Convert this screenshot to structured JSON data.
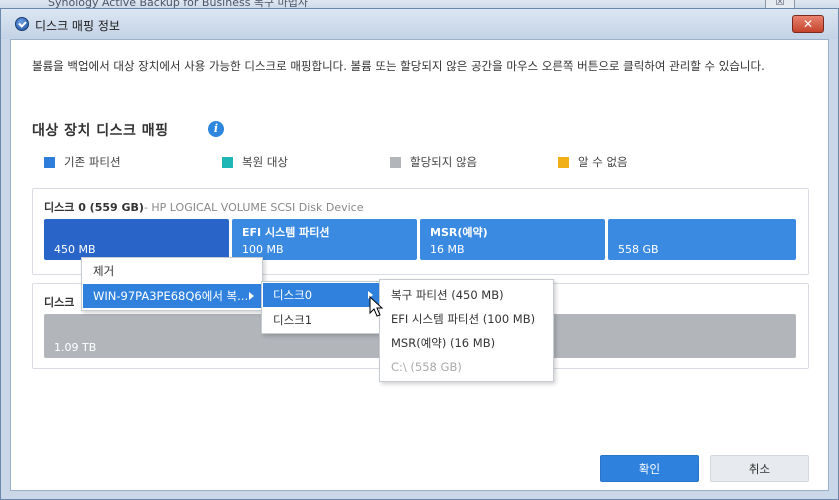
{
  "background_window": {
    "title": "Synology Active Backup for Business 복구 마법사",
    "close_label": "☒"
  },
  "dialog": {
    "title": "디스크 매핑 정보",
    "close_label": "✕",
    "description": "볼륨을 백업에서 대상 장치에서 사용 가능한 디스크로 매핑합니다. 볼륨 또는 할당되지 않은 공간을 마우스 오른쪽 버튼으로 클릭하여 관리할 수 있습니다.",
    "section_title": "대상 장치 디스크 매핑",
    "info_icon": "i"
  },
  "legend": [
    {
      "label": "기존 파티션",
      "color": "#2f7ddb"
    },
    {
      "label": "복원 대상",
      "color": "#1fb6b6"
    },
    {
      "label": "할당되지 않음",
      "color": "#b2b6bb"
    },
    {
      "label": "알 수 없음",
      "color": "#f2b017"
    }
  ],
  "disks": [
    {
      "name": "디스크 0 (559 GB)",
      "model": "- HP LOGICAL VOLUME SCSI Disk Device",
      "partitions": [
        {
          "name": "",
          "size": "450 MB"
        },
        {
          "name": "EFI 시스템 파티션",
          "size": "100 MB"
        },
        {
          "name": "MSR(예약)",
          "size": "16 MB"
        },
        {
          "name": "",
          "size": "558 GB"
        }
      ]
    },
    {
      "name": "디스크",
      "partitions": [
        {
          "name": "",
          "size": "1.09 TB"
        }
      ]
    }
  ],
  "context_menu": {
    "items": [
      "제거",
      "WIN-97PA3PE68Q6에서 복..."
    ]
  },
  "submenu_disks": {
    "items": [
      "디스크0",
      "디스크1"
    ]
  },
  "submenu_partitions": {
    "items": [
      "복구 파티션 (450 MB)",
      "EFI 시스템 파티션 (100 MB)",
      "MSR(예약) (16 MB)",
      "C:\\ (558 GB)"
    ]
  },
  "buttons": {
    "ok": "확인",
    "cancel": "취소"
  },
  "colors": {
    "accent": "#2e82de",
    "partition_existing": "#3a8ae2",
    "partition_selected": "#2965c9",
    "unallocated": "#b2b6bb"
  }
}
